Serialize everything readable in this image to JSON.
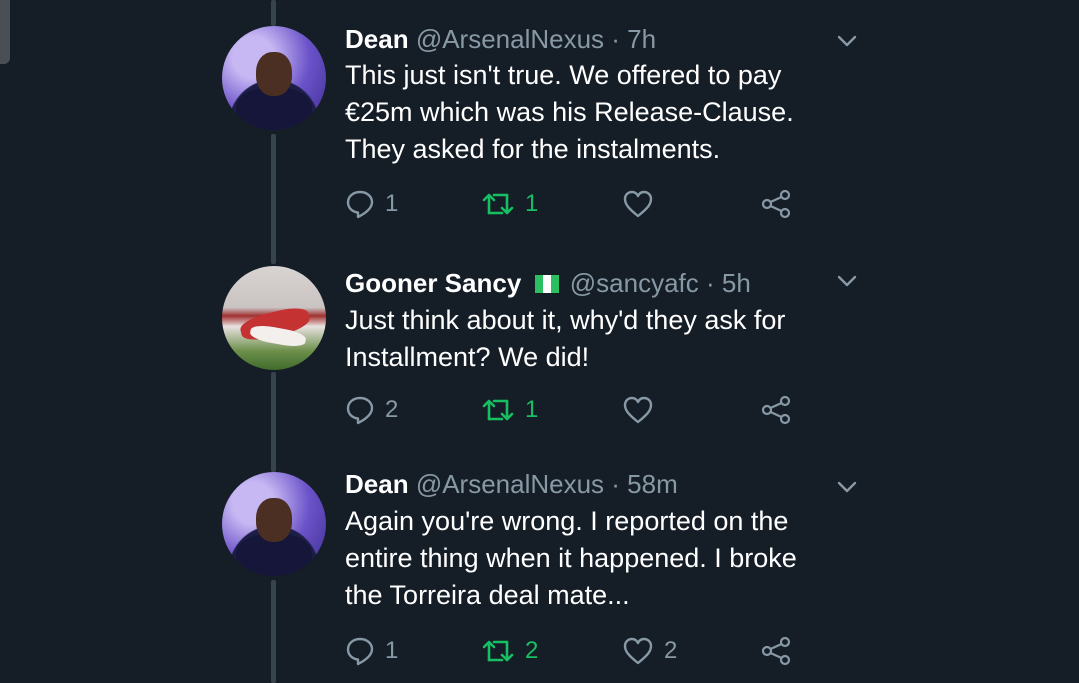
{
  "tweets": [
    {
      "display_name": "Dean",
      "handle": "@ArsenalNexus",
      "time": "· 7h",
      "avatar": "dean-avatar",
      "lines": [
        "This just isn't true. We offered to pay",
        "€25m which was his Release-Clause.",
        "They asked for the instalments."
      ],
      "replies": "1",
      "retweets": "1",
      "likes": ""
    },
    {
      "display_name": "Gooner Sancy",
      "flag": "nigeria-flag",
      "handle": "@sancyafc",
      "time": "· 5h",
      "avatar": "sancy-avatar",
      "lines": [
        "Just think about it, why'd they ask for",
        "Installment? We did!"
      ],
      "replies": "2",
      "retweets": "1",
      "likes": ""
    },
    {
      "display_name": "Dean",
      "handle": "@ArsenalNexus",
      "time": "· 58m",
      "avatar": "dean-avatar",
      "lines": [
        "Again you're wrong. I reported on the",
        "entire thing when it happened. I broke",
        "the Torreira deal mate..."
      ],
      "replies": "1",
      "retweets": "2",
      "likes": "2"
    }
  ],
  "colors": {
    "background": "#151d27",
    "text": "#ffffff",
    "secondary": "#8899a6",
    "retweet_green": "#17bf63",
    "thread_line": "#38444d"
  },
  "icons": [
    "reply-icon",
    "retweet-icon",
    "like-icon",
    "share-icon",
    "chevron-down-icon"
  ]
}
